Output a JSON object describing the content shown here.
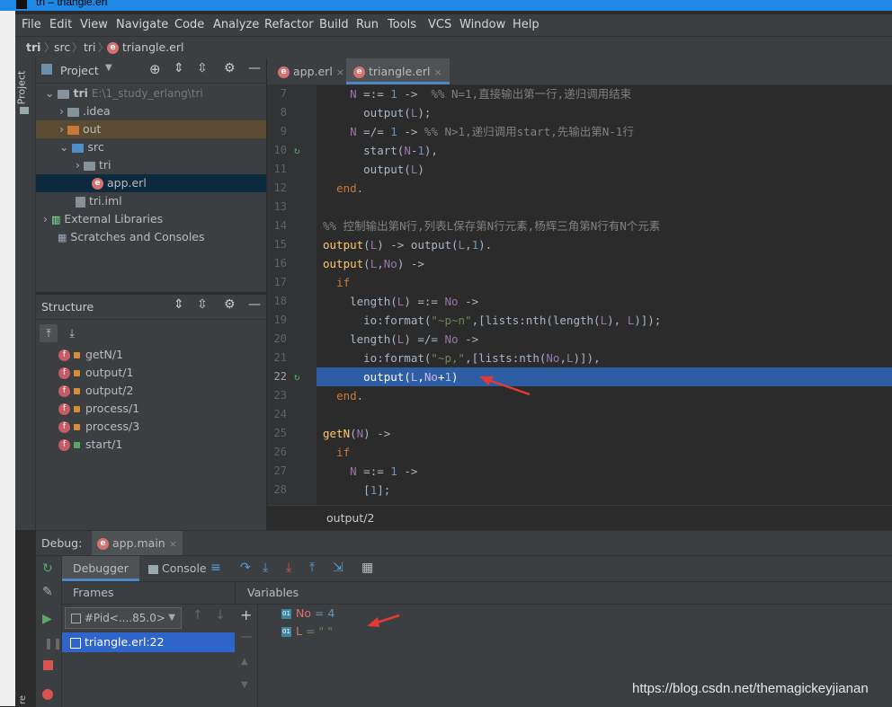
{
  "window": {
    "title": "tri – triangle.erl"
  },
  "menu": [
    "File",
    "Edit",
    "View",
    "Navigate",
    "Code",
    "Analyze",
    "Refactor",
    "Build",
    "Run",
    "Tools",
    "VCS",
    "Window",
    "Help"
  ],
  "breadcrumb": {
    "project": "tri",
    "folder1": "src",
    "folder2": "tri",
    "file": "triangle.erl"
  },
  "project_panel": {
    "title": "Project",
    "side_label": "Project",
    "root": "tri",
    "root_path": "E:\\1_study_erlang\\tri",
    "items": [
      ".idea",
      "out",
      "src",
      "tri",
      "app.erl",
      "tri.iml",
      "External Libraries",
      "Scratches and Consoles"
    ]
  },
  "structure_panel": {
    "title": "Structure",
    "items": [
      "getN/1",
      "output/1",
      "output/2",
      "process/1",
      "process/3",
      "start/1"
    ]
  },
  "editor": {
    "tabs": [
      "app.erl",
      "triangle.erl"
    ],
    "active_tab": "triangle.erl",
    "line_numbers": [
      "7",
      "8",
      "9",
      "10",
      "11",
      "12",
      "13",
      "14",
      "15",
      "16",
      "17",
      "18",
      "19",
      "20",
      "21",
      "22",
      "23",
      "24",
      "25",
      "26",
      "27",
      "28"
    ],
    "status_function": "output/2"
  },
  "debug": {
    "label": "Debug:",
    "session": "app.main",
    "tabs": [
      "Debugger",
      "Console"
    ],
    "frames_title": "Frames",
    "variables_title": "Variables",
    "thread_combo": "#Pid<....85.0>",
    "frame_selected": "triangle.erl:22",
    "variables": [
      {
        "name": "No",
        "value": "= 4"
      },
      {
        "name": "L",
        "value": "= \"     \""
      }
    ]
  },
  "watermark": "https://blog.csdn.net/themagickeyjianan",
  "colors": {
    "editor_bg": "#2b2b2b",
    "panel_bg": "#3c3f41",
    "highlight": "#2d5ea3",
    "annotation": "#e53935"
  }
}
